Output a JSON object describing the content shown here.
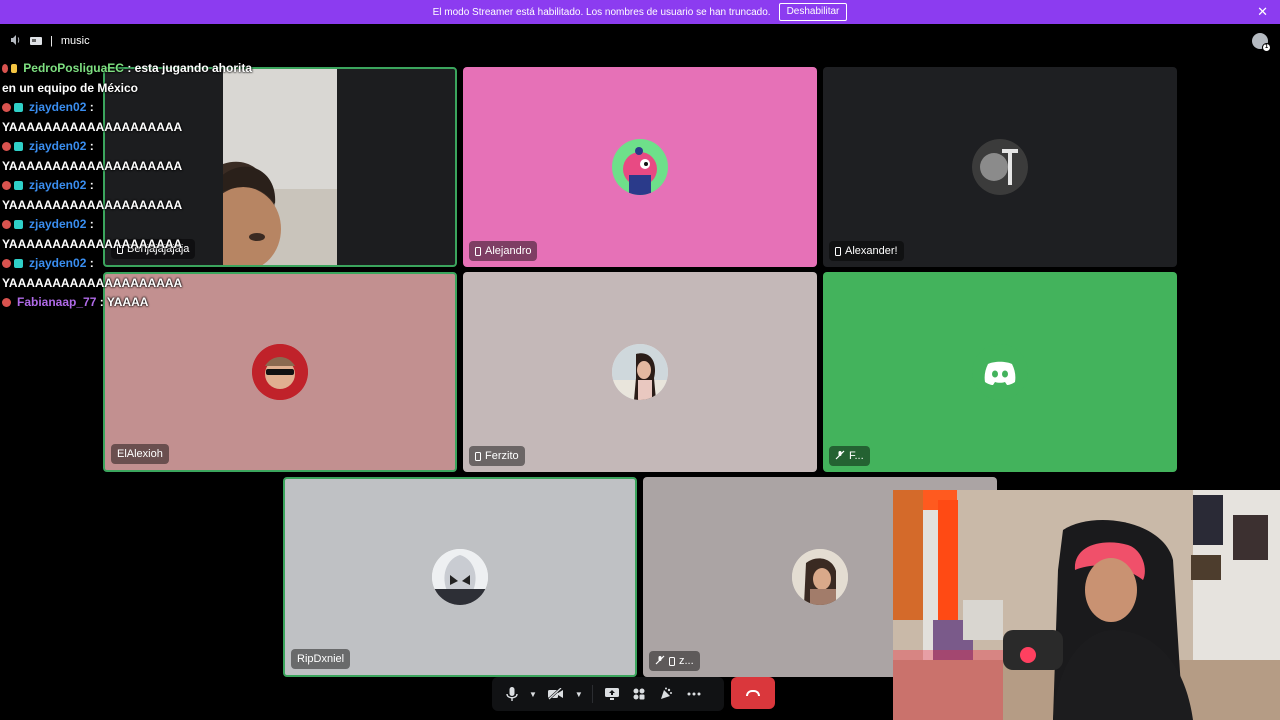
{
  "banner": {
    "message": "El modo Streamer está habilitado. Los nombres de usuario se han truncado.",
    "disable_label": "Deshabilitar",
    "close_glyph": "✕",
    "color": "#8c3cf0"
  },
  "header": {
    "speaker_icon": "speaker-icon",
    "channel_name": "music"
  },
  "chat": [
    {
      "user": "PedroPosliguaEC",
      "user_color": "#7ee081",
      "badge_color": "#f4c542",
      "text": ": esta jugando ahorita",
      "continuation": "en un equipo de México"
    },
    {
      "user": "zjayden02",
      "user_color": "#3a8ef0",
      "badge_color": "#2fd0c8",
      "text": ":",
      "continuation": "YAAAAAAAAAAAAAAAAAAAA"
    },
    {
      "user": "zjayden02",
      "user_color": "#3a8ef0",
      "badge_color": "#2fd0c8",
      "text": ":",
      "continuation": "YAAAAAAAAAAAAAAAAAAAA"
    },
    {
      "user": "zjayden02",
      "user_color": "#3a8ef0",
      "badge_color": "#2fd0c8",
      "text": ":",
      "continuation": "YAAAAAAAAAAAAAAAAAAAA"
    },
    {
      "user": "zjayden02",
      "user_color": "#3a8ef0",
      "badge_color": "#2fd0c8",
      "text": ":",
      "continuation": "YAAAAAAAAAAAAAAAAAAAA"
    },
    {
      "user": "zjayden02",
      "user_color": "#3a8ef0",
      "badge_color": "#2fd0c8",
      "text": ":",
      "continuation": "YAAAAAAAAAAAAAAAAAAAA"
    },
    {
      "user": "Fabianaap_77",
      "user_color": "#b06ae8",
      "badge_color": "",
      "text": ": YAAAA",
      "continuation": ""
    }
  ],
  "tiles": [
    {
      "name": "Benjajajajaja",
      "device": "phone",
      "bg": "#1c1d1f",
      "speaking": true,
      "video": true
    },
    {
      "name": "Alejandro",
      "device": "phone",
      "bg": "#e671b7",
      "speaking": false
    },
    {
      "name": "Alexander!",
      "device": "phone",
      "bg": "#1e1f22",
      "speaking": false
    },
    {
      "name": "ElAlexioh",
      "device": "",
      "bg": "#c29090",
      "speaking": true
    },
    {
      "name": "Ferzito",
      "device": "phone",
      "bg": "#c4b8b8",
      "speaking": false
    },
    {
      "name": "F...",
      "device": "muted",
      "bg": "#43b35c",
      "speaking": false
    },
    {
      "name": "RipDxniel",
      "device": "",
      "bg": "#bfc1c4",
      "speaking": true
    },
    {
      "name": "z...",
      "device": "muted-phone",
      "bg": "#aba4a4",
      "speaking": false
    }
  ],
  "controls": {
    "mic_icon": "microphone-icon",
    "camera_icon": "camera-off-icon",
    "share_icon": "screen-share-icon",
    "activities_icon": "activities-icon",
    "soundboard_icon": "soundboard-icon",
    "more_icon": "more-icon",
    "hangup_icon": "hang-up-icon",
    "hangup_color": "#da373c"
  }
}
